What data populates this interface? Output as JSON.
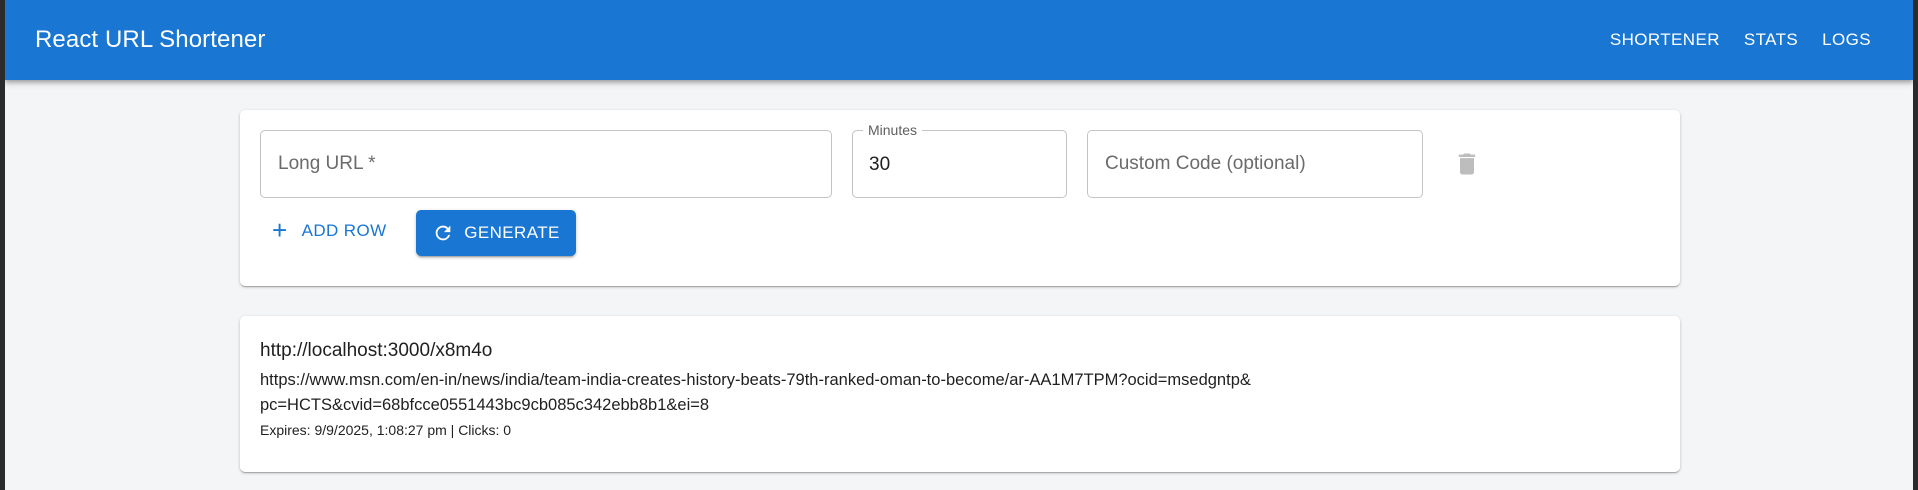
{
  "app": {
    "title": "React URL Shortener",
    "accent_color": "#1976d2"
  },
  "nav": {
    "items": [
      {
        "label": "SHORTENER"
      },
      {
        "label": "STATS"
      },
      {
        "label": "LOGS"
      }
    ]
  },
  "form": {
    "rows": [
      {
        "long_url": {
          "label": "Long URL *",
          "value": ""
        },
        "minutes": {
          "label": "Minutes",
          "value": "30"
        },
        "custom_code": {
          "label": "Custom Code (optional)",
          "value": ""
        },
        "delete_icon": "trash-icon"
      }
    ],
    "add_row_label": "ADD ROW",
    "add_row_icon": "plus-icon",
    "generate_label": "GENERATE",
    "generate_icon": "refresh-icon"
  },
  "results": [
    {
      "short_url": "http://localhost:3000/x8m4o",
      "long_url": "https://www.msn.com/en-in/news/india/team-india-creates-history-beats-79th-ranked-oman-to-become/ar-AA1M7TPM?ocid=msedgntp&pc=HCTS&cvid=68bfcce0551443bc9cb085c342ebb8b1&ei=8",
      "meta": "Expires: 9/9/2025, 1:08:27 pm | Clicks: 0"
    }
  ]
}
